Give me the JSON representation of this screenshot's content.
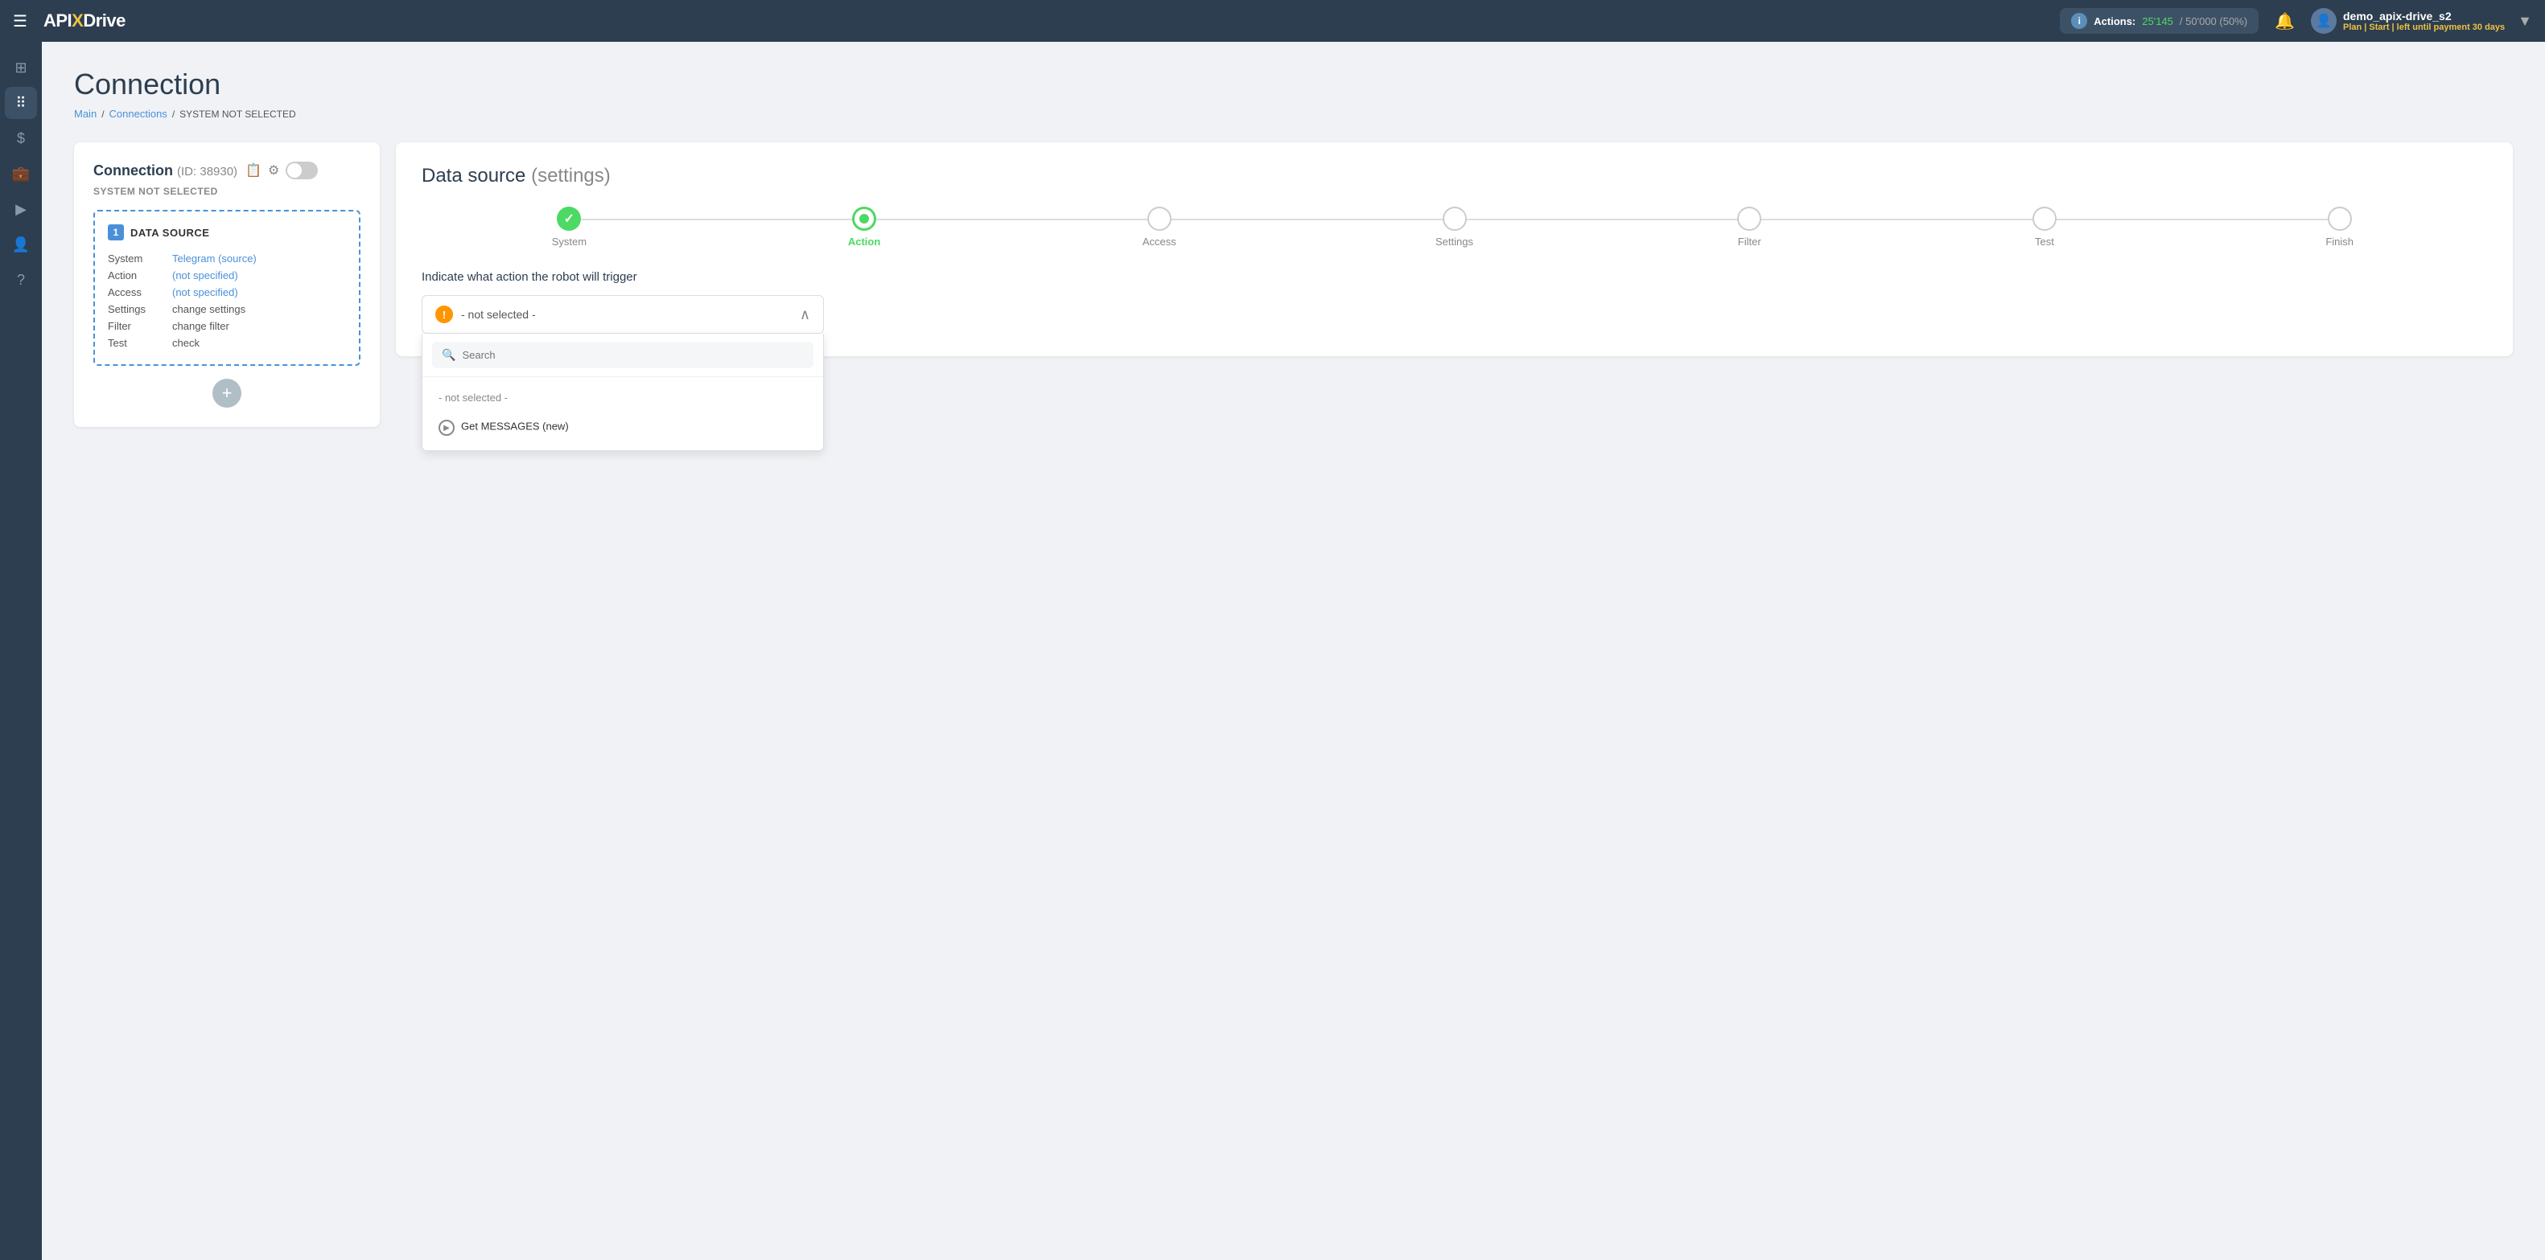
{
  "navbar": {
    "logo": {
      "api": "API",
      "x": "X",
      "drive": "Drive"
    },
    "hamburger_label": "☰",
    "actions_label": "Actions:",
    "actions_used": "25'145",
    "actions_total": "50'000",
    "actions_pct": "(50%)",
    "user_name": "demo_apix-drive_s2",
    "user_plan": "Plan | Start | left until payment",
    "user_days": "30 days",
    "expand_icon": "✓"
  },
  "sidebar": {
    "items": [
      {
        "icon": "⊞",
        "label": "home"
      },
      {
        "icon": "⠿",
        "label": "connections"
      },
      {
        "icon": "$",
        "label": "billing"
      },
      {
        "icon": "💼",
        "label": "briefcase"
      },
      {
        "icon": "▶",
        "label": "play"
      },
      {
        "icon": "👤",
        "label": "user"
      },
      {
        "icon": "?",
        "label": "help"
      }
    ]
  },
  "page": {
    "title": "Connection",
    "breadcrumb": {
      "main": "Main",
      "connections": "Connections",
      "current": "SYSTEM NOT SELECTED"
    }
  },
  "left_card": {
    "title": "Connection",
    "id": "(ID: 38930)",
    "system_status": "SYSTEM NOT SELECTED",
    "data_source": {
      "number": "1",
      "title": "DATA SOURCE",
      "rows": [
        {
          "label": "System",
          "value": "Telegram (source)",
          "plain": false
        },
        {
          "label": "Action",
          "value": "(not specified)",
          "plain": false
        },
        {
          "label": "Access",
          "value": "(not specified)",
          "plain": false
        },
        {
          "label": "Settings",
          "value": "change settings",
          "plain": true
        },
        {
          "label": "Filter",
          "value": "change filter",
          "plain": true
        },
        {
          "label": "Test",
          "value": "check",
          "plain": true
        }
      ]
    },
    "add_button": "+"
  },
  "right_card": {
    "title": "Data source",
    "subtitle": "(settings)",
    "steps": [
      {
        "label": "System",
        "state": "done"
      },
      {
        "label": "Action",
        "state": "active"
      },
      {
        "label": "Access",
        "state": "inactive"
      },
      {
        "label": "Settings",
        "state": "inactive"
      },
      {
        "label": "Filter",
        "state": "inactive"
      },
      {
        "label": "Test",
        "state": "inactive"
      },
      {
        "label": "Finish",
        "state": "inactive"
      }
    ],
    "action_prompt": "Indicate what action the robot will trigger",
    "dropdown": {
      "selected": "- not selected -",
      "search_placeholder": "Search",
      "options": [
        {
          "text": "- not selected -",
          "type": "not_selected"
        },
        {
          "text": "Get MESSAGES (new)",
          "type": "option"
        }
      ]
    }
  }
}
